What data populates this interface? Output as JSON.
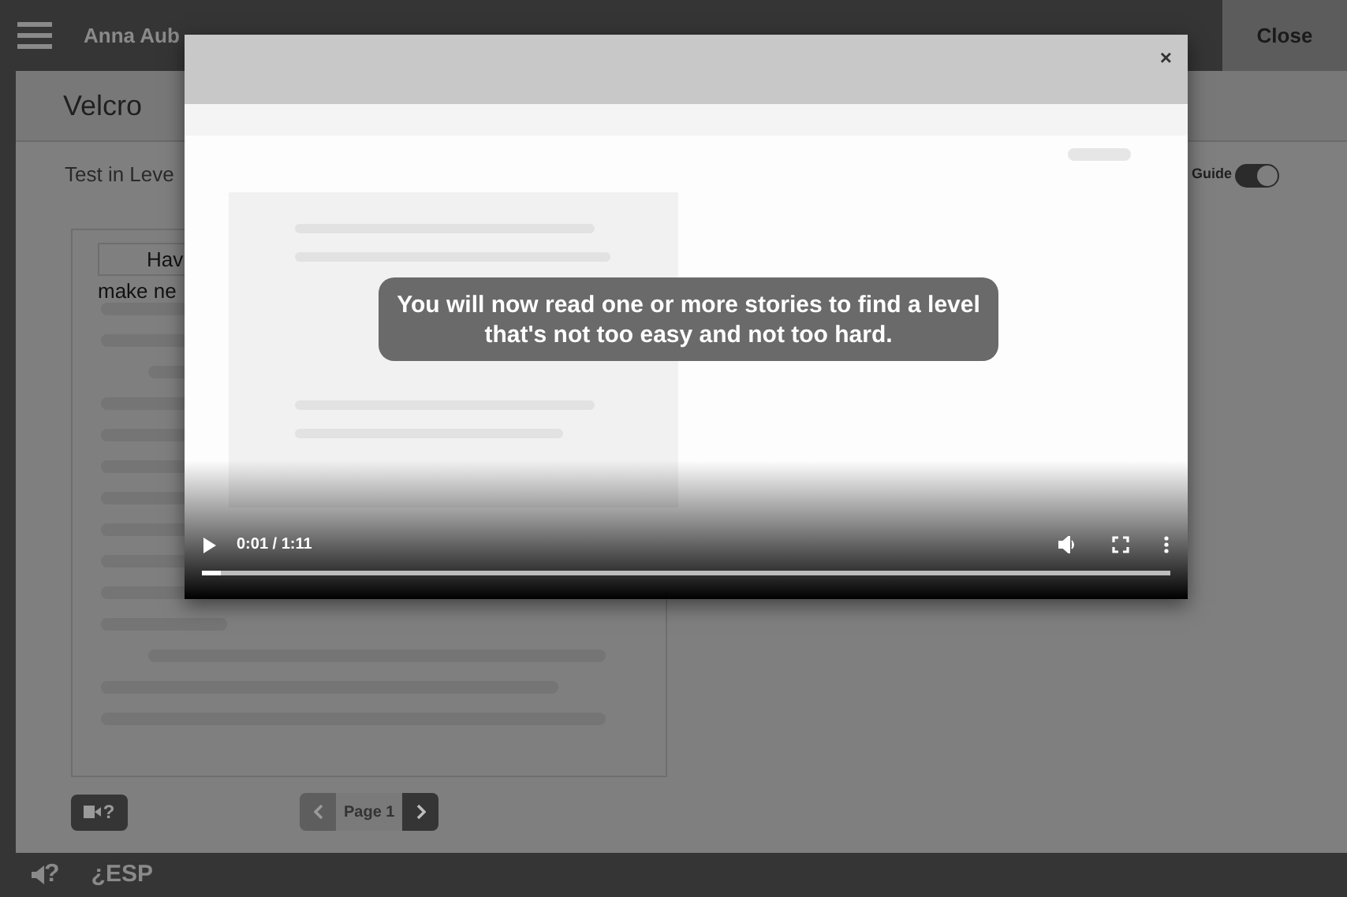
{
  "top_bar": {
    "user_name": "Anna Aub",
    "close_button": "Close"
  },
  "title": "Velcro",
  "subtitle": "Test in Leve",
  "guide_toggle": {
    "label": "Guide",
    "on": true
  },
  "reading_panel": {
    "lines": [
      "Hav",
      "make ne"
    ]
  },
  "help_button": "?",
  "pager": {
    "label": "Page 1",
    "prev_disabled": true,
    "next_disabled": false
  },
  "bottom_bar": {
    "language": "¿ESP",
    "audio_help": "?"
  },
  "video": {
    "caption": "You will now read one or more stories to find a level that's not too easy and not too hard.",
    "time": "0:01 / 1:11",
    "level": 0.02,
    "close": "×"
  }
}
